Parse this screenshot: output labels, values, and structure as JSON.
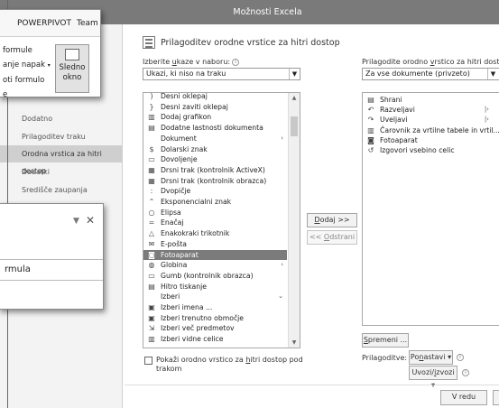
{
  "dialog": {
    "title": "Možnosti Excela",
    "nav": [
      "Dodatno",
      "Prilagoditev traku",
      "Orodna vrstica za hitri dostop",
      "Dodatki",
      "Središče zaupanja"
    ],
    "nav_selected": 2
  },
  "header": {
    "text": "Prilagoditev orodne vrstice za hitri dostop"
  },
  "left_col": {
    "label_pre": "Izberite ",
    "label_u": "u",
    "label_post": "kaze v naboru:",
    "select": "Ukazi, ki niso na traku",
    "items": [
      {
        "icon": ")",
        "label": "Desni oklepaj"
      },
      {
        "icon": "}",
        "label": "Desni zaviti oklepaj"
      },
      {
        "icon": "▥",
        "label": "Dodaj grafikon"
      },
      {
        "icon": "▤",
        "label": "Dodatne lastnosti dokumenta"
      },
      {
        "icon": "",
        "label": "Dokument",
        "sub": "›"
      },
      {
        "icon": "$",
        "label": "Dolarski znak"
      },
      {
        "icon": "▭",
        "label": "Dovoljenje"
      },
      {
        "icon": "▦",
        "label": "Drsni trak (kontrolnik ActiveX)"
      },
      {
        "icon": "▦",
        "label": "Drsni trak (kontrolnik obrazca)"
      },
      {
        "icon": ":",
        "label": "Dvopičje"
      },
      {
        "icon": "⌃",
        "label": "Eksponencialni znak"
      },
      {
        "icon": "○",
        "label": "Elipsa"
      },
      {
        "icon": "=",
        "label": "Enačaj"
      },
      {
        "icon": "△",
        "label": "Enakokraki trikotnik"
      },
      {
        "icon": "✉",
        "label": "E-pošta"
      },
      {
        "icon": "◙",
        "label": "Fotoaparat",
        "selected": true
      },
      {
        "icon": "◍",
        "label": "Globina",
        "sub": "›"
      },
      {
        "icon": "▭",
        "label": "Gumb (kontrolnik obrazca)"
      },
      {
        "icon": "▤",
        "label": "Hitro tiskanje"
      },
      {
        "icon": "",
        "label": "Izberi",
        "sub": "⌄"
      },
      {
        "icon": "▣",
        "label": "Izberi imena ..."
      },
      {
        "icon": "▣",
        "label": "Izberi trenutno območje"
      },
      {
        "icon": "⇲",
        "label": "Izberi več predmetov"
      },
      {
        "icon": "▥",
        "label": "Izberi vidne celice"
      }
    ],
    "checkbox_label": "Pokaži orodno vrstico za ",
    "checkbox_u": "h",
    "checkbox_post": "itri dostop pod",
    "checkbox_line2": "trakom"
  },
  "middle": {
    "add_pre": "",
    "add_u": "D",
    "add_post": "odaj >>",
    "remove_pre": "<< ",
    "remove_u": "O",
    "remove_post": "dstrani"
  },
  "right_col": {
    "label_pre": "Prilagodite orodno ",
    "label_u": "v",
    "label_post": "rstico za hitri dostop:",
    "select": "Za vse dokumente (privzeto)",
    "items": [
      {
        "icon": "▤",
        "label": "Shrani"
      },
      {
        "icon": "↶",
        "label": "Razveljavi",
        "sub": "|›"
      },
      {
        "icon": "↷",
        "label": "Uveljavi",
        "sub": "|›"
      },
      {
        "icon": "▥",
        "label": "Čarovnik za vrtilne tabele in vrtil..."
      },
      {
        "icon": "◙",
        "label": "Fotoaparat"
      },
      {
        "icon": "↺",
        "label": "Izgovori vsebino celic"
      }
    ],
    "modify_pre": "",
    "modify_u": "S",
    "modify_post": "premeni ...",
    "custom_label": "Prilagoditve:",
    "reset_pre": "Po",
    "reset_u": "n",
    "reset_post": "astavi",
    "io_pre": "Uvozi/",
    "io_u": "i",
    "io_post": "zvozi"
  },
  "footer": {
    "ok": "V redu"
  },
  "ribbon": {
    "tabs": [
      "POWERPIVOT",
      "Team"
    ],
    "lines": [
      "formule",
      "anje napak",
      "oti formulo",
      "e"
    ],
    "btn1": "Sledno",
    "btn2": "okno"
  },
  "pane": {
    "text": "rmula"
  }
}
